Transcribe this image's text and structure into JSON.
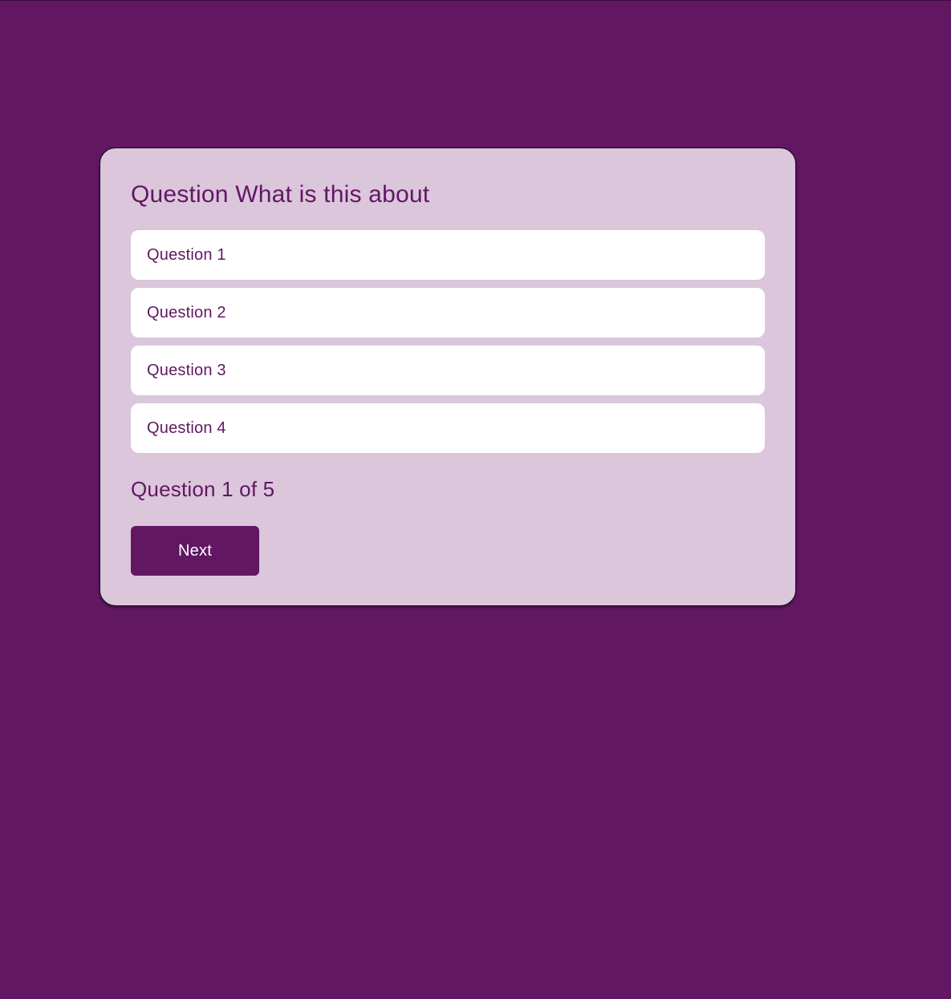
{
  "colors": {
    "background": "#611762",
    "card": "#dbc6dc",
    "option": "#ffffff",
    "accent": "#611762",
    "button_text": "#ffffff"
  },
  "quiz": {
    "title": "Question What is this about",
    "options": [
      {
        "label": "Question 1"
      },
      {
        "label": "Question 2"
      },
      {
        "label": "Question 3"
      },
      {
        "label": "Question 4"
      }
    ],
    "progress": "Question 1 of 5",
    "next_label": "Next"
  }
}
